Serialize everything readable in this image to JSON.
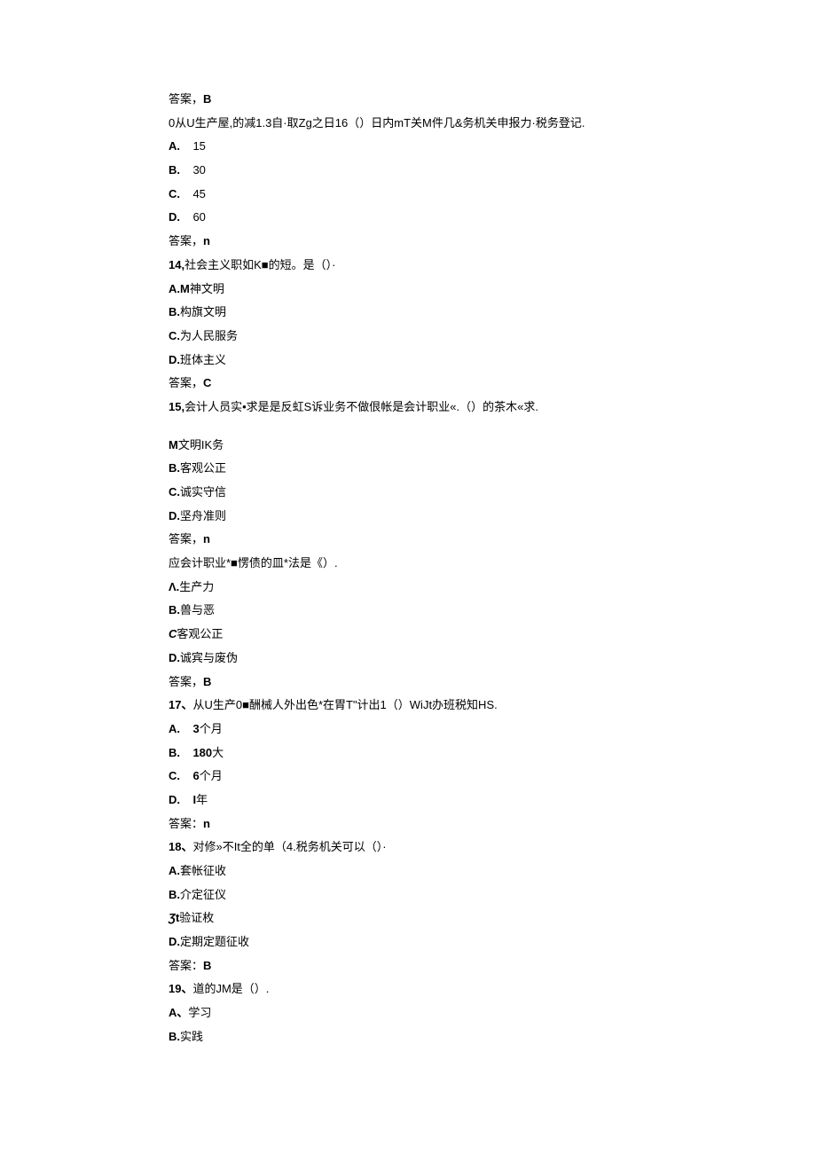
{
  "lines": [
    {
      "text": "答案，",
      "bold_suffix": "B"
    },
    {
      "text": "0从U生产屋,的减1.3自·取Zg之日16（）日内mT关M件几&务机关申报力·税务登记."
    },
    {
      "option": true,
      "label": "A.",
      "gap": true,
      "value": "15"
    },
    {
      "option": true,
      "label": "B.",
      "gap": true,
      "value": "30"
    },
    {
      "option": true,
      "label": "C.",
      "gap": true,
      "value": "45"
    },
    {
      "option": true,
      "label": "D.",
      "gap": true,
      "value": "60"
    },
    {
      "text": "答案，",
      "bold_suffix": "n"
    },
    {
      "bold_prefix": "14,",
      "text": "社会主义职如K■的短。是（）·"
    },
    {
      "option": true,
      "label": "A.M",
      "value": "神文明"
    },
    {
      "option": true,
      "label": "B.",
      "value": "构旗文明"
    },
    {
      "option": true,
      "label": "C.",
      "value": "为人民服务"
    },
    {
      "option": true,
      "label": "D.",
      "value": "班体主义"
    },
    {
      "text": "答案，",
      "bold_suffix": "C"
    },
    {
      "bold_prefix": "15,",
      "text": "会计人员实•求是是反虹S诉业务不做佷帐是会计职业«.（）的茶木«求."
    },
    {
      "spacer": true
    },
    {
      "option": true,
      "label": "M",
      "value": "文明IK务"
    },
    {
      "option": true,
      "label": "B.",
      "value": "客观公正"
    },
    {
      "option": true,
      "label": "C.",
      "value": "诚实守信"
    },
    {
      "option": true,
      "label": "D.",
      "value": "坚舟准则"
    },
    {
      "text": "答案，",
      "bold_suffix": "n"
    },
    {
      "text": "应会计职业*■愣债的皿*法是《）."
    },
    {
      "option": true,
      "label": "Λ.",
      "value": "生产力"
    },
    {
      "option": true,
      "label": "B.",
      "value": "兽与恶"
    },
    {
      "option": true,
      "label_italic": "C",
      "value": "客观公正"
    },
    {
      "option": true,
      "label": "D.",
      "value": "诚宾与废伪"
    },
    {
      "text": "答案，",
      "bold_suffix": "B"
    },
    {
      "bold_prefix": "17、",
      "text": "从U生产0■酬械人外出色*在胃T\"计出1（）WiJt办班税知HS."
    },
    {
      "option": true,
      "label": "A.",
      "gap": true,
      "value_bold": "3",
      "value_tail": "个月"
    },
    {
      "option": true,
      "label": "B.",
      "gap": true,
      "value_bold": "180",
      "value_tail": "大"
    },
    {
      "option": true,
      "label": "C.",
      "gap": true,
      "value_bold": "6",
      "value_tail": "个月"
    },
    {
      "option": true,
      "label": "D.",
      "gap": true,
      "value_bold": "I",
      "value_tail": "年"
    },
    {
      "text": "答案：",
      "bold_suffix": "n"
    },
    {
      "bold_prefix": "18、",
      "text": "对修»不It全的单（4.税务机关可以（）·"
    },
    {
      "option": true,
      "label": "A.",
      "value": "套帐征收"
    },
    {
      "option": true,
      "label": "B.",
      "value": "介定征仪"
    },
    {
      "option": true,
      "label_italic_bold": "Ʒ",
      "label_bold": "t",
      "value": "验证枚"
    },
    {
      "option": true,
      "label": "D.",
      "value": "定期定题征收"
    },
    {
      "text": "答案：",
      "bold_suffix": "B"
    },
    {
      "bold_prefix": "19、",
      "text": "道的JM是（）."
    },
    {
      "option": true,
      "label": "A、",
      "value": "学习"
    },
    {
      "option": true,
      "label": "B.",
      "value": "实践"
    }
  ]
}
